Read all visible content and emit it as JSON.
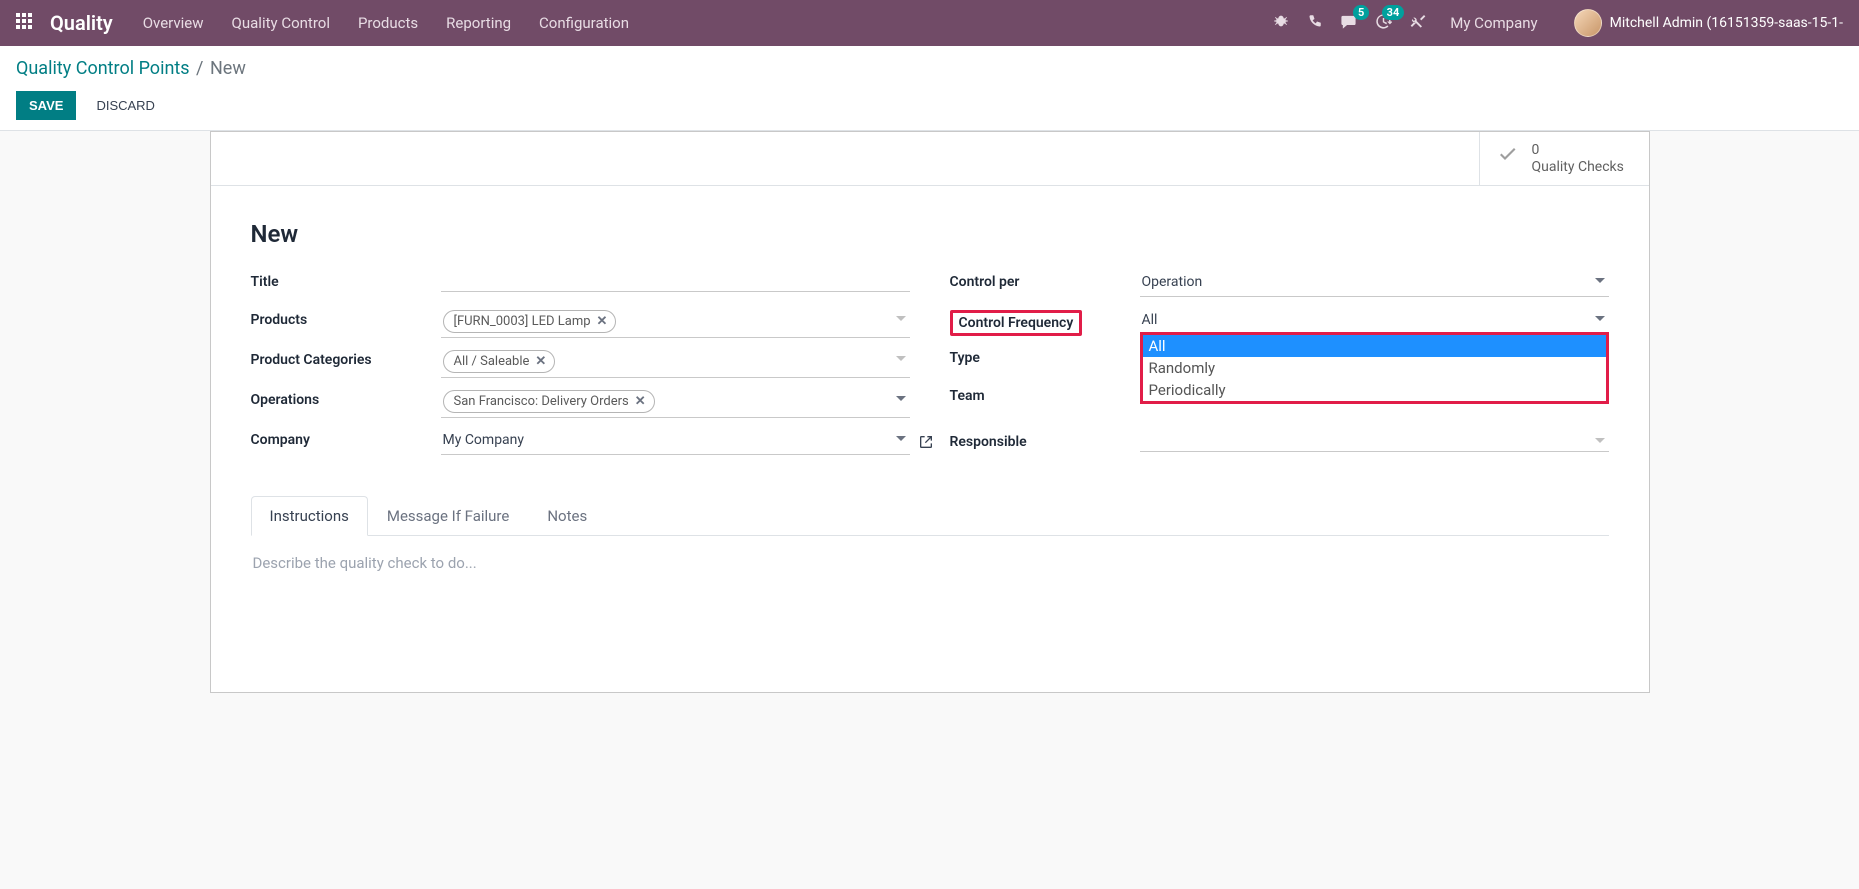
{
  "navbar": {
    "brand": "Quality",
    "menu": [
      "Overview",
      "Quality Control",
      "Products",
      "Reporting",
      "Configuration"
    ],
    "badges": {
      "messages": "5",
      "activities": "34"
    },
    "company": "My Company",
    "user": "Mitchell Admin (16151359-saas-15-1-"
  },
  "breadcrumb": {
    "root": "Quality Control Points",
    "current": "New"
  },
  "buttons": {
    "save": "SAVE",
    "discard": "DISCARD"
  },
  "stat": {
    "count": "0",
    "label": "Quality Checks"
  },
  "form": {
    "title": "New",
    "left": {
      "title_label": "Title",
      "products_label": "Products",
      "products_tags": [
        "[FURN_0003] LED Lamp"
      ],
      "categories_label": "Product Categories",
      "categories_tags": [
        "All / Saleable"
      ],
      "operations_label": "Operations",
      "operations_tags": [
        "San Francisco: Delivery Orders"
      ],
      "company_label": "Company",
      "company_value": "My Company"
    },
    "right": {
      "control_per_label": "Control per",
      "control_per_value": "Operation",
      "control_freq_label": "Control Frequency",
      "control_freq_value": "All",
      "control_freq_options": [
        "All",
        "Randomly",
        "Periodically"
      ],
      "type_label": "Type",
      "team_label": "Team",
      "responsible_label": "Responsible"
    }
  },
  "tabs": {
    "items": [
      "Instructions",
      "Message If Failure",
      "Notes"
    ],
    "placeholder": "Describe the quality check to do..."
  }
}
